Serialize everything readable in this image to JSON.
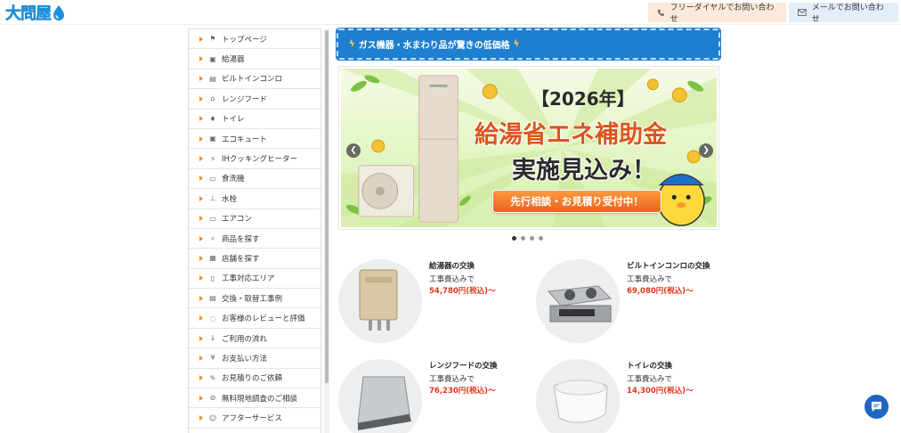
{
  "header": {
    "logo_text": "大問屋",
    "phone_button": "フリーダイヤルでお問い合わせ",
    "mail_button": "メールでお問い合わせ"
  },
  "sidebar": {
    "items": [
      {
        "label": "トップページ",
        "icon": "flag-icon"
      },
      {
        "label": "給湯器",
        "icon": "water-heater-icon"
      },
      {
        "label": "ビルトインコンロ",
        "icon": "stove-icon"
      },
      {
        "label": "レンジフード",
        "icon": "range-hood-icon"
      },
      {
        "label": "トイレ",
        "icon": "toilet-icon"
      },
      {
        "label": "エコキュート",
        "icon": "eco-cute-icon"
      },
      {
        "label": "IHクッキングヒーター",
        "icon": "ih-heater-icon"
      },
      {
        "label": "食洗機",
        "icon": "dishwasher-icon"
      },
      {
        "label": "水栓",
        "icon": "faucet-icon"
      },
      {
        "label": "エアコン",
        "icon": "air-conditioner-icon"
      },
      {
        "label": "商品を探す",
        "icon": "search-icon"
      },
      {
        "label": "店舗を探す",
        "icon": "store-icon"
      },
      {
        "label": "工事対応エリア",
        "icon": "map-icon"
      },
      {
        "label": "交換・取替工事例",
        "icon": "document-icon"
      },
      {
        "label": "お客様のレビューと評価",
        "icon": "chat-bubble-icon"
      },
      {
        "label": "ご利用の流れ",
        "icon": "flow-icon"
      },
      {
        "label": "お支払い方法",
        "icon": "yen-icon"
      },
      {
        "label": "お見積りのご依頼",
        "icon": "edit-icon"
      },
      {
        "label": "無料現地調査のご相談",
        "icon": "compass-icon"
      },
      {
        "label": "アフターサービス",
        "icon": "support-icon"
      }
    ]
  },
  "notice": {
    "text": "ガス機器・水まわり品が驚きの低価格"
  },
  "banner": {
    "year": "【2026年】",
    "headline": "給湯省エネ補助金",
    "subheadline": "実施見込み！",
    "cta": "先行相談・お見積り受付中！",
    "slides_total": 4,
    "slide_active": 1
  },
  "products": [
    {
      "title": "給湯器の交換",
      "sub": "工事費込みで",
      "price": "54,780円(税込)〜",
      "icon": "water-heater-image"
    },
    {
      "title": "ビルトインコンロの交換",
      "sub": "工事費込みで",
      "price": "69,080円(税込)〜",
      "icon": "stove-image"
    },
    {
      "title": "レンジフードの交換",
      "sub": "工事費込みで",
      "price": "76,230円(税込)〜",
      "icon": "range-hood-image"
    },
    {
      "title": "トイレの交換",
      "sub": "工事費込みで",
      "price": "14,300円(税込)〜",
      "icon": "toilet-image"
    }
  ],
  "colors": {
    "brand_blue": "#1f7fd0",
    "accent_orange": "#f08a1c",
    "price_red": "#e0351c"
  }
}
